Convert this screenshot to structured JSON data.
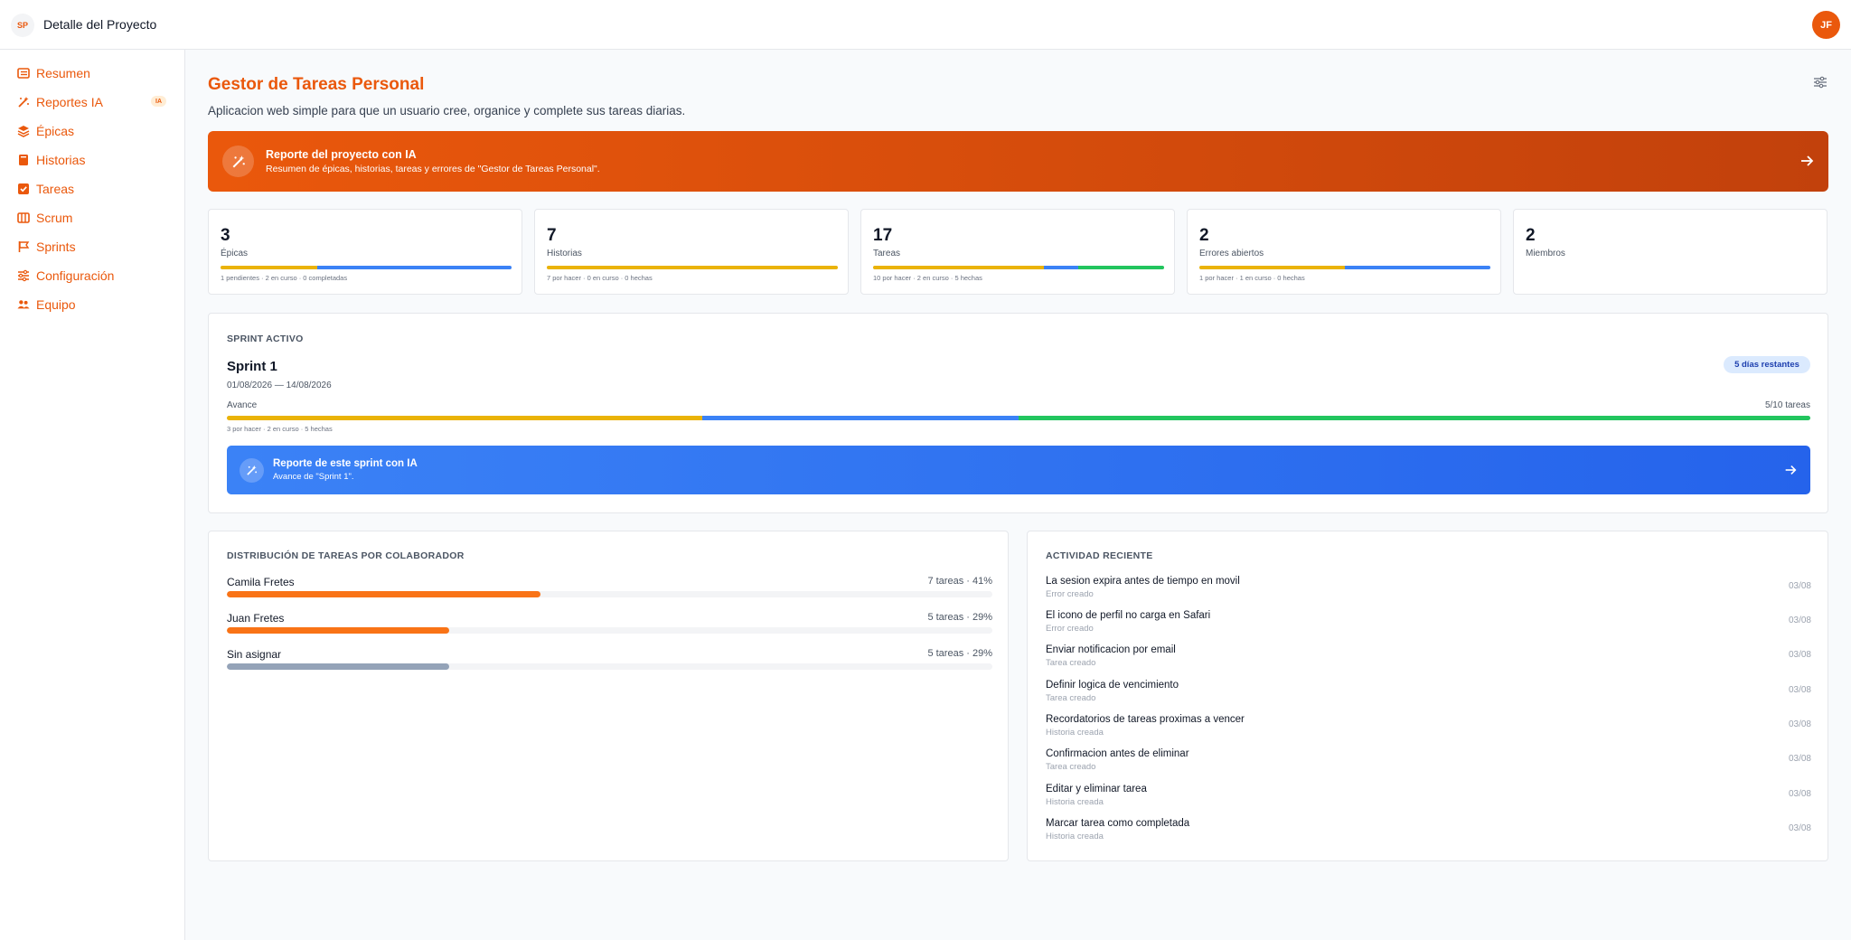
{
  "header": {
    "logo_initials": "SP",
    "title": "Detalle del Proyecto",
    "user_initials": "JF"
  },
  "sidebar": {
    "items": [
      {
        "label": "Resumen",
        "icon": "list-icon"
      },
      {
        "label": "Reportes IA",
        "icon": "magic-wand-icon",
        "badge": "IA"
      },
      {
        "label": "Épicas",
        "icon": "layers-icon"
      },
      {
        "label": "Historias",
        "icon": "book-icon"
      },
      {
        "label": "Tareas",
        "icon": "checkbox-icon"
      },
      {
        "label": "Scrum",
        "icon": "board-icon"
      },
      {
        "label": "Sprints",
        "icon": "flag-icon"
      },
      {
        "label": "Configuración",
        "icon": "sliders-icon"
      },
      {
        "label": "Equipo",
        "icon": "users-icon"
      }
    ]
  },
  "project": {
    "title": "Gestor de Tareas Personal",
    "description": "Aplicacion web simple para que un usuario cree, organice y complete sus tareas diarias."
  },
  "ai_banner": {
    "title": "Reporte del proyecto con IA",
    "subtitle": "Resumen de épicas, historias, tareas y errores de \"Gestor de Tareas Personal\"."
  },
  "stats": [
    {
      "value": "3",
      "label": "Épicas",
      "note": "1 pendientes · 2 en curso · 0 completadas",
      "segments": [
        1,
        2,
        0
      ]
    },
    {
      "value": "7",
      "label": "Historias",
      "note": "7 por hacer · 0 en curso · 0 hechas",
      "segments": [
        7,
        0,
        0
      ]
    },
    {
      "value": "17",
      "label": "Tareas",
      "note": "10 por hacer · 2 en curso · 5 hechas",
      "segments": [
        10,
        2,
        5
      ]
    },
    {
      "value": "2",
      "label": "Errores abiertos",
      "note": "1 por hacer · 1 en curso · 0 hechas",
      "segments": [
        1,
        1,
        0
      ]
    },
    {
      "value": "2",
      "label": "Miembros",
      "note": "",
      "segments": []
    }
  ],
  "colors": {
    "accent": "#ea580c",
    "todo": "#eab308",
    "doing": "#3b82f6",
    "done": "#22c55e",
    "unassigned": "#94a3b8"
  },
  "sprint": {
    "section_title": "SPRINT ACTIVO",
    "name": "Sprint 1",
    "dates": "01/08/2026 — 14/08/2026",
    "days_left": "5 días restantes",
    "progress_label": "Avance",
    "progress_value": "5/10 tareas",
    "segments": [
      3,
      2,
      5
    ],
    "note": "3 por hacer · 2 en curso · 5 hechas",
    "ai_title": "Reporte de este sprint con IA",
    "ai_subtitle": "Avance de \"Sprint 1\"."
  },
  "distribution": {
    "title": "DISTRIBUCIÓN DE TAREAS POR COLABORADOR",
    "rows": [
      {
        "name": "Camila Fretes",
        "meta": "7 tareas · 41%",
        "percent": 41,
        "color": "#f97316"
      },
      {
        "name": "Juan Fretes",
        "meta": "5 tareas · 29%",
        "percent": 29,
        "color": "#f97316"
      },
      {
        "name": "Sin asignar",
        "meta": "5 tareas · 29%",
        "percent": 29,
        "color": "#94a3b8"
      }
    ]
  },
  "activity": {
    "title": "ACTIVIDAD RECIENTE",
    "items": [
      {
        "title": "La sesion expira antes de tiempo en movil",
        "sub": "Error creado",
        "date": "03/08"
      },
      {
        "title": "El icono de perfil no carga en Safari",
        "sub": "Error creado",
        "date": "03/08"
      },
      {
        "title": "Enviar notificacion por email",
        "sub": "Tarea creado",
        "date": "03/08"
      },
      {
        "title": "Definir logica de vencimiento",
        "sub": "Tarea creado",
        "date": "03/08"
      },
      {
        "title": "Recordatorios de tareas proximas a vencer",
        "sub": "Historia creada",
        "date": "03/08"
      },
      {
        "title": "Confirmacion antes de eliminar",
        "sub": "Tarea creado",
        "date": "03/08"
      },
      {
        "title": "Editar y eliminar tarea",
        "sub": "Historia creada",
        "date": "03/08"
      },
      {
        "title": "Marcar tarea como completada",
        "sub": "Historia creada",
        "date": "03/08"
      }
    ]
  }
}
